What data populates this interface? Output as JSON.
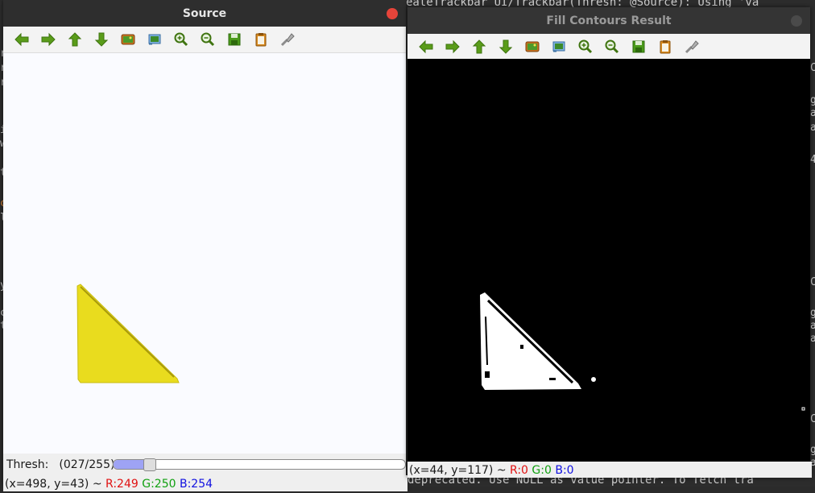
{
  "terminal": {
    "top_line": "eateTrackbar UI/Trackbar(Thresh: @Source): Using 'va",
    "bottom_line": "deprecated. Use NULL as value pointer. To fetch tra",
    "right_col_chars": [
      "C",
      "g",
      "a",
      "a",
      "4",
      "C",
      "g",
      "a",
      "a",
      "C",
      "g",
      "a"
    ]
  },
  "source_window": {
    "title": "Source",
    "toolbar": [
      "arrow-left-icon",
      "arrow-right-icon",
      "arrow-up-icon",
      "arrow-down-icon",
      "save-image-icon",
      "zoom-fit-icon",
      "zoom-in-icon",
      "zoom-out-icon",
      "save-icon",
      "copy-icon",
      "properties-icon"
    ],
    "trackbar": {
      "label": "Thresh:",
      "value_text": "(027/255)",
      "value": 27,
      "max": 255
    },
    "status": {
      "coords": "(x=498, y=43) ~",
      "r": "R:249",
      "g": "G:250",
      "b": "B:254"
    }
  },
  "result_window": {
    "title": "Fill Contours Result",
    "toolbar": [
      "arrow-left-icon",
      "arrow-right-icon",
      "arrow-up-icon",
      "arrow-down-icon",
      "save-image-icon",
      "zoom-fit-icon",
      "zoom-in-icon",
      "zoom-out-icon",
      "save-icon",
      "copy-icon",
      "properties-icon"
    ],
    "status": {
      "coords": "(x=44, y=117) ~",
      "r": "R:0",
      "g": "G:0",
      "b": "B:0"
    }
  },
  "colors": {
    "shape_yellow": "#e9dc1e",
    "slider_fill": "#9ea3f5",
    "close_active": "#e6443a"
  }
}
